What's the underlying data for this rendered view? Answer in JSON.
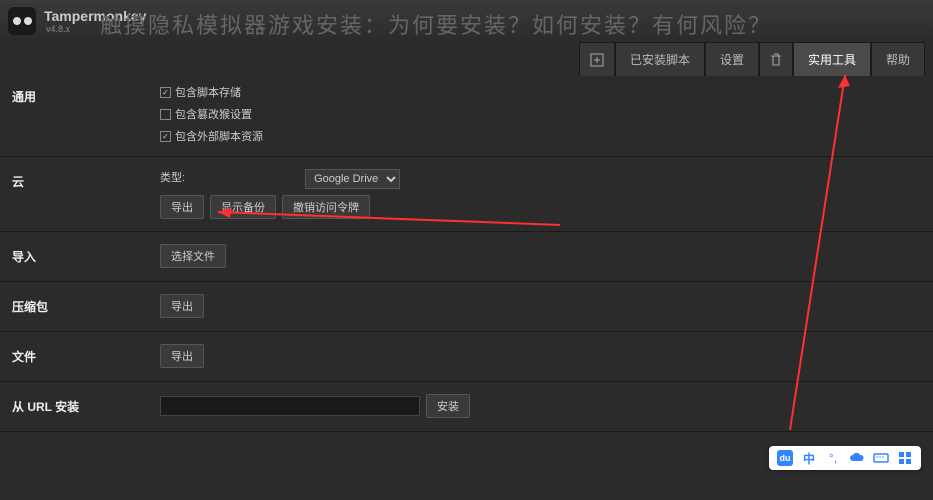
{
  "app": {
    "name": "Tampermonkey",
    "version": "v4.8.x"
  },
  "overlay_title": "触摸隐私模拟器游戏安装：为何要安装？如何安装？有何风险？",
  "tabs": {
    "installed": "已安装脚本",
    "settings": "设置",
    "utilities": "实用工具",
    "help": "帮助"
  },
  "sections": {
    "general": {
      "label": "通用",
      "chk1": "包含脚本存储",
      "chk2": "包含篡改猴设置",
      "chk3": "包含外部脚本资源"
    },
    "cloud": {
      "label": "云",
      "type_label": "类型:",
      "select_value": "Google Drive",
      "export": "导出",
      "show_backup": "显示备份",
      "revoke": "撤销访问令牌"
    },
    "import": {
      "label": "导入",
      "choose_file": "选择文件"
    },
    "zip": {
      "label": "压缩包",
      "export": "导出"
    },
    "file": {
      "label": "文件",
      "export": "导出"
    },
    "url": {
      "label": "从 URL 安装",
      "install": "安装"
    }
  },
  "toolbar": {
    "lang": "中"
  }
}
